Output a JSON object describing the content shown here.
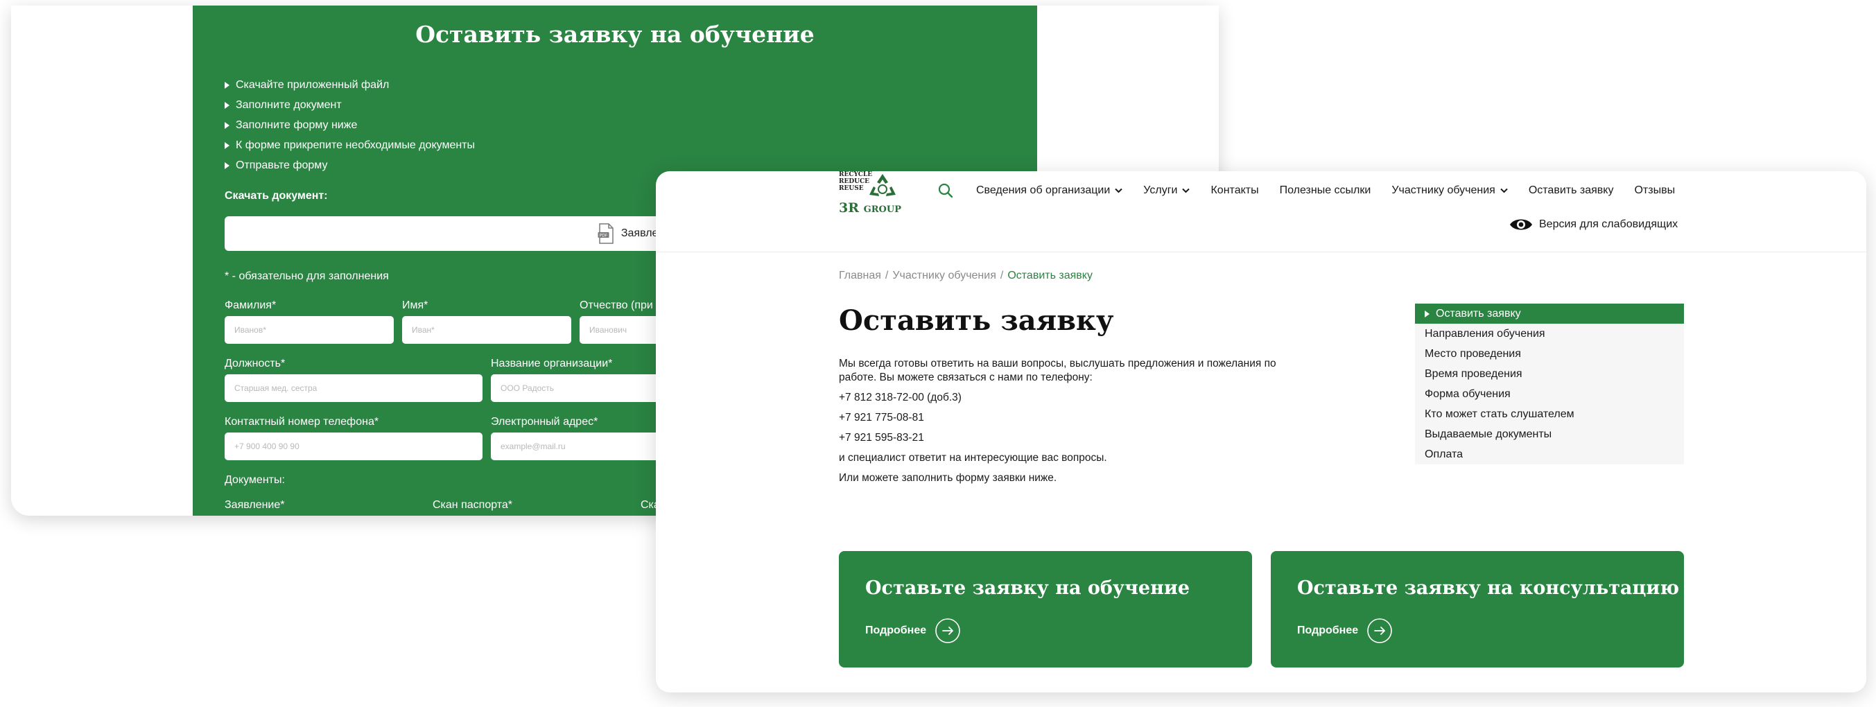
{
  "form_card": {
    "title": "Оставить заявку на обучение",
    "steps": [
      "Скачайте приложенный файл",
      "Заполните документ",
      "Заполните форму ниже",
      "К форме прикрепите необходимые документы",
      "Отправьте форму"
    ],
    "download_heading": "Скачать документ:",
    "download_file_label": "Заявление",
    "required_note": "* - обязательно для заполнения",
    "fields": {
      "surname": {
        "label": "Фамилия*",
        "placeholder": "Иванов*"
      },
      "name": {
        "label": "Имя*",
        "placeholder": "Иван*"
      },
      "patronymic": {
        "label": "Отчество (при",
        "placeholder": "Иванович"
      },
      "position": {
        "label": "Должность*",
        "placeholder": "Старшая мед. сестра"
      },
      "organization": {
        "label": "Название организации*",
        "placeholder": "ООО Радость"
      },
      "phone": {
        "label": "Контактный номер телефона*",
        "placeholder": "+7 900 400 90 90"
      },
      "email": {
        "label": "Электронный адрес*",
        "placeholder": "example@mail.ru"
      }
    },
    "documents_heading": "Документы:",
    "doc_labels": [
      "Заявление*",
      "Скан паспорта*",
      "Ска"
    ]
  },
  "site": {
    "logo": {
      "words": [
        "RECYCLE",
        "REDUCE",
        "REUSE"
      ],
      "brand": "3R",
      "brand_suffix": "GROUP"
    },
    "nav": [
      {
        "label": "Сведения об организации",
        "has_dropdown": true
      },
      {
        "label": "Услуги",
        "has_dropdown": true
      },
      {
        "label": "Контакты",
        "has_dropdown": false
      },
      {
        "label": "Полезные ссылки",
        "has_dropdown": false
      },
      {
        "label": "Участнику обучения",
        "has_dropdown": true
      },
      {
        "label": "Оставить заявку",
        "has_dropdown": false
      },
      {
        "label": "Отзывы",
        "has_dropdown": false
      }
    ],
    "accessibility_label": "Версия для слабовидящих",
    "breadcrumb": [
      "Главная",
      "Участнику обучения",
      "Оставить заявку"
    ],
    "page_title": "Оставить заявку",
    "content": [
      "Мы всегда готовы ответить на ваши вопросы, выслушать предложения и пожелания по работе. Вы можете связаться с нами по телефону:",
      "+7 812 318-72-00 (доб.3)",
      "+7 921 775-08-81",
      "+7 921 595-83-21",
      "и специалист ответит на интересующие вас вопросы.",
      "Или можете заполнить форму заявки ниже."
    ],
    "side_menu": [
      "Оставить заявку",
      "Направления обучения",
      "Место проведения",
      "Время проведения",
      "Форма обучения",
      "Кто может стать слушателем",
      "Выдаваемые документы",
      "Оплата"
    ],
    "cta_cards": [
      {
        "title": "Оставьте заявку на обучение",
        "link": "Подробнее"
      },
      {
        "title": "Оставьте заявку на консультацию",
        "link": "Подробнее"
      }
    ]
  },
  "colors": {
    "accent": "#2a8442",
    "text": "#1a1a1a",
    "muted": "#8a8a8a"
  }
}
